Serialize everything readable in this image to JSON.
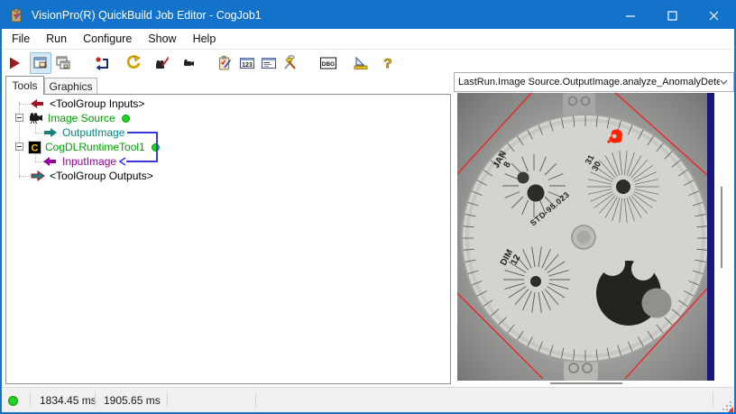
{
  "window": {
    "title": "VisionPro(R) QuickBuild Job Editor - CogJob1"
  },
  "menu": {
    "items": [
      "File",
      "Run",
      "Configure",
      "Show",
      "Help"
    ]
  },
  "toolbar": {
    "icons": [
      "run-icon",
      "show-job-icon",
      "cascade-windows-icon",
      "reset-icon",
      "refresh-icon",
      "edit-acquisition-icon",
      "camera-icon",
      "job-edit-icon",
      "posted-items-icon",
      "properties-icon",
      "options-icon",
      "debug-icon",
      "measure-icon",
      "help-icon"
    ]
  },
  "tabs": [
    {
      "label": "Tools",
      "active": true
    },
    {
      "label": "Graphics",
      "active": false
    }
  ],
  "tree": {
    "items": [
      {
        "label": "<ToolGroup Inputs>",
        "icon": "input-arrow-icon",
        "color": "#000000"
      },
      {
        "label": "Image Source",
        "icon": "camera-tool-icon",
        "color": "#00A000",
        "status_dot": "#1FD41F"
      },
      {
        "label": "OutputImage",
        "icon": "output-arrow-icon",
        "color": "#008888"
      },
      {
        "label": "CogDLRuntimeTool1",
        "icon": "dl-tool-icon",
        "color": "#00A000",
        "status_dot": "#1FD41F"
      },
      {
        "label": "InputImage",
        "icon": "input-arrow-icon",
        "color": "#990099"
      },
      {
        "label": "<ToolGroup Outputs>",
        "icon": "output-arrow-icon",
        "color": "#000000"
      }
    ],
    "connection": "OutputImage -> InputImage"
  },
  "display": {
    "selected_record": "LastRun.Image Source.OutputImage.analyze_AnomalyDete"
  },
  "image": {
    "description": "grayscale watch dial with moonphase, red region-of-interest diamond and red anomaly highlight",
    "labels": {
      "subdial_left_1": "JAN",
      "subdial_left_2": "8",
      "subdial_right_1": "31",
      "subdial_right_2": "30",
      "serial": "STD-95.023",
      "subdial_bottom_1": "DIM",
      "subdial_bottom_2": "12"
    },
    "overlays": [
      "red-diamond-region",
      "anomaly-highlight"
    ]
  },
  "statusbar": {
    "led_color": "#1FD41F",
    "time1": "1834.45 ms",
    "time2": "1905.65 ms"
  },
  "colors": {
    "titlebar": "#1372CA",
    "accent": "#1372CA",
    "connector": "#3A3ADF",
    "overlay_red": "#FF1414",
    "anomaly": "#FF2400",
    "image_side_bar": "#17177F",
    "tree_green": "#00A000",
    "tree_teal": "#008888",
    "tree_purple": "#990099"
  }
}
